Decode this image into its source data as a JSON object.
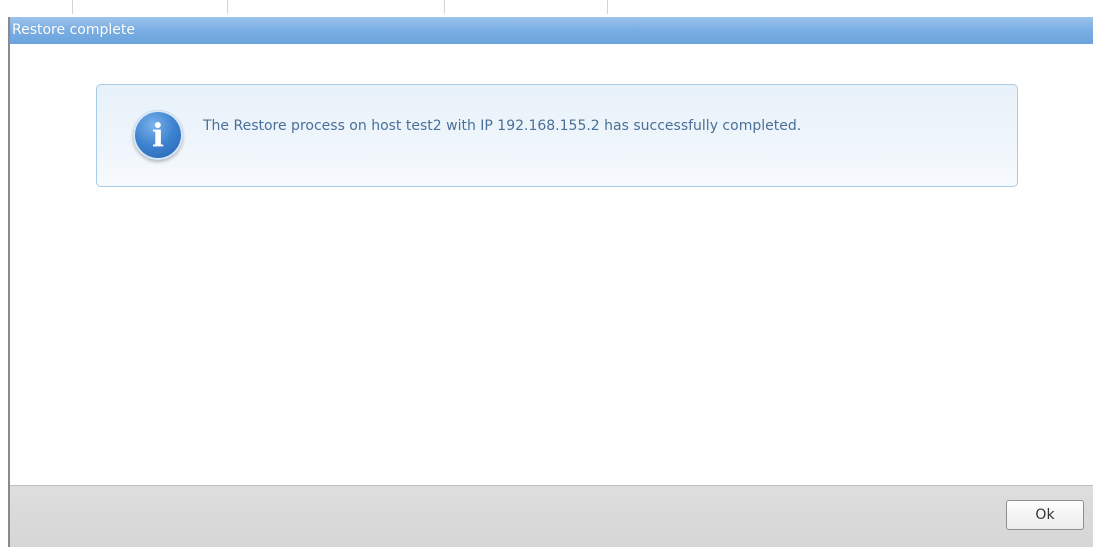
{
  "dialog": {
    "title": "Restore complete",
    "message": "The Restore process on host test2 with IP 192.168.155.2 has successfully completed.",
    "icon": "info-icon",
    "icon_glyph": "i",
    "ok_label": "Ok"
  },
  "colors": {
    "titlebar": "#79aee4",
    "message_text": "#4a6f98",
    "info_box_border": "#a9cbe6",
    "footer": "#d6d6d6"
  }
}
